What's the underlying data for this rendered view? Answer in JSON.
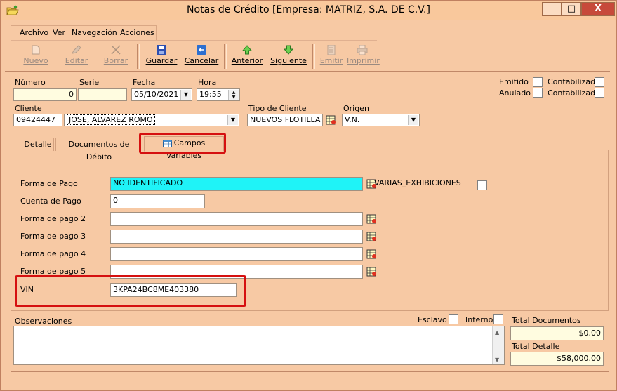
{
  "window": {
    "title": "Notas de Crédito [Empresa: MATRIZ, S.A. DE C.V.]",
    "minimize": "_",
    "maximize": "□",
    "close": "X"
  },
  "menu": [
    "Archivo",
    "Ver",
    "Navegación",
    "Acciones"
  ],
  "toolbar": {
    "nuevo": "Nuevo",
    "editar": "Editar",
    "borrar": "Borrar",
    "guardar": "Guardar",
    "cancelar": "Cancelar",
    "anterior": "Anterior",
    "siguiente": "Siguiente",
    "emitir": "Emitir",
    "imprimir": "Imprimir"
  },
  "header": {
    "numero_label": "Número",
    "numero_value": "0",
    "serie_label": "Serie",
    "serie_value": "",
    "fecha_label": "Fecha",
    "fecha_value": "05/10/2021",
    "hora_label": "Hora",
    "hora_value": "19:55",
    "emitido_label": "Emitido",
    "anulado_label": "Anulado",
    "contabilizado_label": "Contabilizado",
    "cliente_label": "Cliente",
    "cliente_code": "09424447",
    "cliente_name": "JOSE, ALVAREZ ROMO",
    "tipo_cliente_label": "Tipo de Cliente",
    "tipo_cliente_value": "NUEVOS FLOTILLA",
    "origen_label": "Origen",
    "origen_value": "V.N."
  },
  "tabs": {
    "detalle": "Detalle",
    "documentos": "Documentos de Débito",
    "campos": "Campos Variables"
  },
  "campos": {
    "forma_pago_label": "Forma de Pago",
    "forma_pago_value": "NO IDENTIFICADO",
    "varias_label": "VARIAS_EXHIBICIONES",
    "cuenta_pago_label": "Cuenta de Pago",
    "cuenta_pago_value": "0",
    "forma_pago2_label": "Forma de pago 2",
    "forma_pago3_label": "Forma de pago 3",
    "forma_pago4_label": "Forma de pago 4",
    "forma_pago5_label": "Forma de pago 5",
    "vin_label": "VIN",
    "vin_value": "3KPA24BC8ME403380"
  },
  "footer": {
    "observaciones_label": "Observaciones",
    "esclavo_label": "Esclavo",
    "interno_label": "Interno",
    "total_documentos_label": "Total Documentos",
    "total_documentos_value": "$0.00",
    "total_detalle_label": "Total Detalle",
    "total_detalle_value": "$58,000.00"
  },
  "colors": {
    "window_bg": "#f7c9a4",
    "highlight_red": "#d51010",
    "field_cyan": "#1ff3f7",
    "field_yellow": "#fffce0"
  }
}
